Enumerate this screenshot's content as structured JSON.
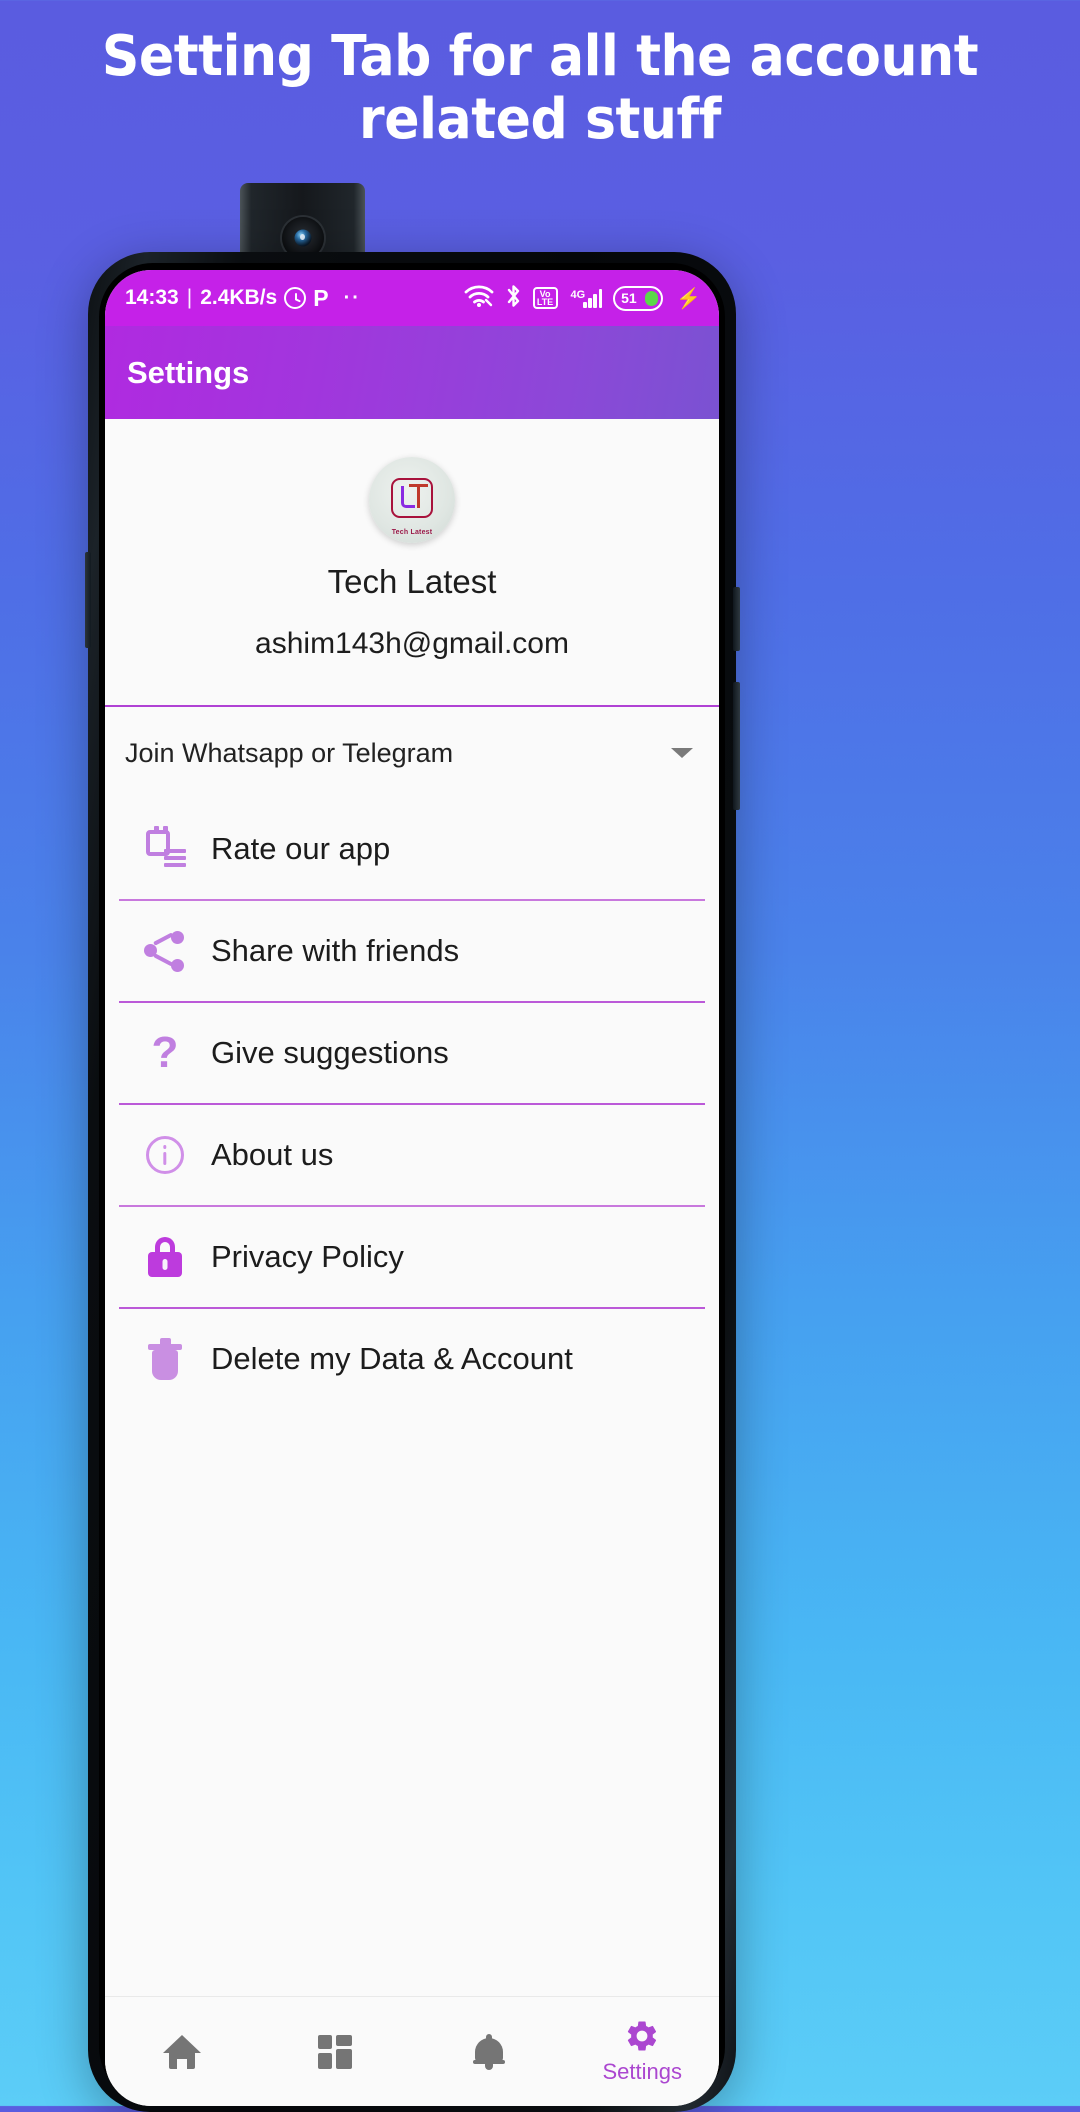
{
  "headline": "Setting Tab for all the account related stuff",
  "colors": {
    "bg_top": "#5a5ce0",
    "bg_bottom": "#5ccdf7",
    "statusbar": "#c521e8",
    "appbar_start": "#b02ae0",
    "appbar_end": "#7a52d2",
    "accent_purple": "#bb59d8",
    "icon_purple": "#c07fe0",
    "nav_active": "#ab47d0",
    "nav_inactive": "#757575",
    "battery_fill": "#5bd94a"
  },
  "statusbar": {
    "time": "14:33",
    "separator": "|",
    "network_speed": "2.4KB/s",
    "alarm_icon": "alarm-icon",
    "p_icon": "P",
    "dots_icon": "··",
    "wifi_icon": "wifi-icon",
    "bluetooth_icon": "bluetooth-icon",
    "volte_top": "Vo",
    "volte_bottom": "LTE",
    "network_type": "4G",
    "signal_icon": "signal-bars-icon",
    "battery_percent": "51",
    "charging_icon": "⚡"
  },
  "appbar": {
    "title": "Settings"
  },
  "profile": {
    "avatar_logo_caption": "Tech Latest",
    "name": "Tech Latest",
    "email": "ashim143h@gmail.com"
  },
  "dropdown": {
    "label": "Join Whatsapp or Telegram",
    "chevron_icon": "chevron-down-icon"
  },
  "menu": {
    "items": [
      {
        "label": "Rate our app",
        "icon": "rate-review-icon"
      },
      {
        "label": "Share with friends",
        "icon": "share-icon"
      },
      {
        "label": "Give suggestions",
        "icon": "question-mark-icon"
      },
      {
        "label": "About us",
        "icon": "info-circle-icon"
      },
      {
        "label": "Privacy Policy",
        "icon": "lock-icon"
      },
      {
        "label": "Delete my Data & Account",
        "icon": "trash-icon"
      }
    ]
  },
  "bottomnav": {
    "items": [
      {
        "label": "",
        "icon": "home-icon",
        "active": false
      },
      {
        "label": "",
        "icon": "dashboard-icon",
        "active": false
      },
      {
        "label": "",
        "icon": "bell-icon",
        "active": false
      },
      {
        "label": "Settings",
        "icon": "gear-icon",
        "active": true
      }
    ]
  }
}
